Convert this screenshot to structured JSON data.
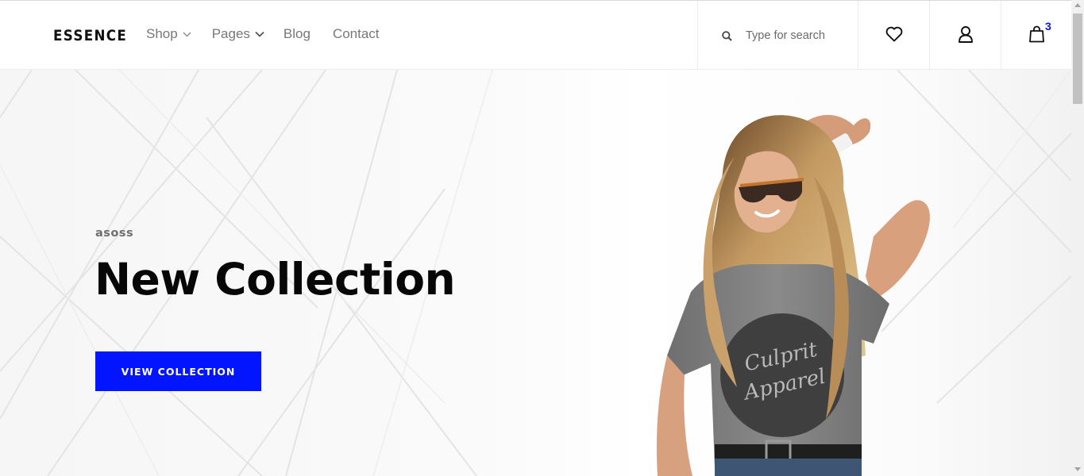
{
  "brand": {
    "logo": "ESSENCE"
  },
  "nav": {
    "shop": "Shop",
    "pages": "Pages",
    "blog": "Blog",
    "contact": "Contact"
  },
  "search": {
    "placeholder": "Type for search"
  },
  "header_icons": {
    "wishlist": "heart-icon",
    "account": "user-icon",
    "cart": "shopping-bag-icon",
    "cart_count": "3"
  },
  "hero": {
    "subtitle": "asoss",
    "title": "New Collection",
    "button_label": "VIEW COLLECTION",
    "model_shirt_text": "Culprit Apparel"
  },
  "colors": {
    "accent": "#0315ff",
    "title": "#070707",
    "nav_text": "#787878"
  }
}
